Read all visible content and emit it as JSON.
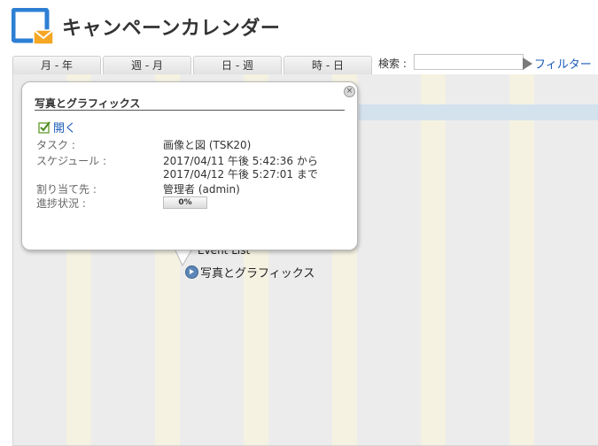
{
  "app": {
    "title": "キャンペーンカレンダー"
  },
  "tabs": [
    {
      "label": "月 - 年"
    },
    {
      "label": "週 - 月"
    },
    {
      "label": "日 - 週"
    },
    {
      "label": "時 - 日"
    }
  ],
  "search": {
    "label": "検索 :",
    "value": "",
    "placeholder": ""
  },
  "filter": {
    "label": "フィルター"
  },
  "calendar": {
    "event": {
      "label": "写真とグラフィックス"
    },
    "hidden_event_text": "Event List"
  },
  "popup": {
    "title": "写真とグラフィックス",
    "open_label": "開く",
    "task": {
      "label": "タスク :",
      "value": "画像と図 (TSK20)"
    },
    "schedule": {
      "label": "スケジュール :",
      "line1": "2017/04/11 午後 5:42:36 から",
      "line2": "2017/04/12 午後 5:27:01 まで"
    },
    "assignee": {
      "label": "割り当て先 :",
      "value": "管理者 (admin)"
    },
    "progress": {
      "label": "進捗状況 :",
      "value": "0%",
      "fraction": 0
    }
  },
  "colors": {
    "accent": "#1a5bb8",
    "icon_blue": "#2d7fd3",
    "icon_orange": "#f5a623",
    "calendar_bg": "#ececec",
    "stripe": "#f5f2e2",
    "highlight_bar": "#d4e2ee"
  },
  "icons": {
    "app": "calendar-mail-icon",
    "open": "checkbox-edit-icon",
    "event": "play-circle-icon",
    "close": "close-icon",
    "filter": "triangle-right-icon"
  }
}
